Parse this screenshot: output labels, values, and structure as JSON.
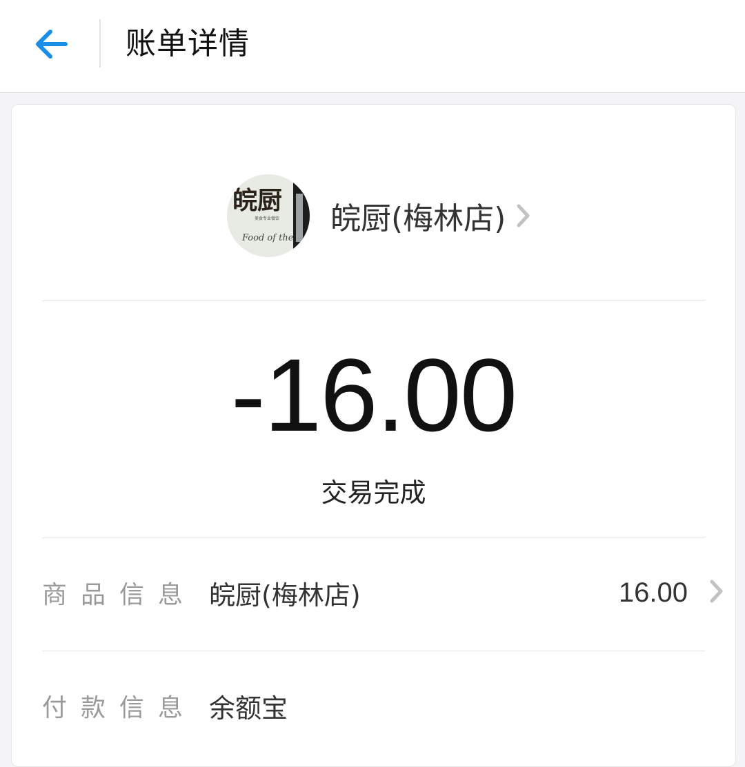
{
  "header": {
    "title": "账单详情",
    "back_icon": "arrow-left-icon",
    "accent": "#1a8ee6"
  },
  "merchant": {
    "name": "皖厨(梅林店)",
    "logo_text": "皖厨",
    "logo_subtext": "Food of the",
    "logo_small": "美食专业餐饮"
  },
  "transaction": {
    "amount": "-16.00",
    "status": "交易完成"
  },
  "details": [
    {
      "label": "商品信息",
      "value": "皖厨(梅林店)",
      "amount": "16.00"
    },
    {
      "label": "付款信息",
      "value": "余额宝"
    }
  ]
}
